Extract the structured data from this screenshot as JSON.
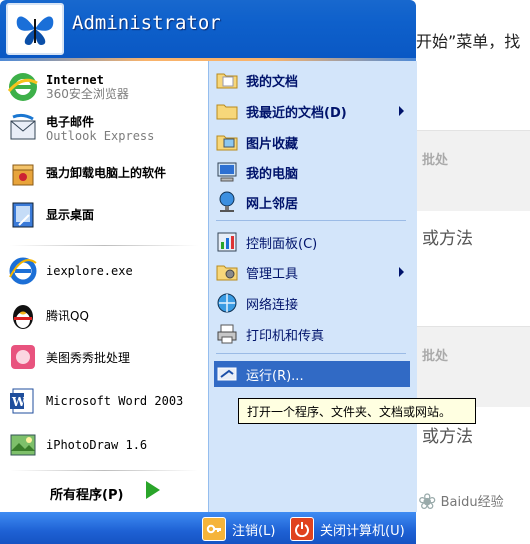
{
  "background": {
    "text1": "开始”菜单，找",
    "card1_label": "批处",
    "card2_text": "或方法",
    "card3_label": "批处",
    "card4_text": "或方法",
    "watermark": "Baidu经验"
  },
  "header": {
    "user": "Administrator"
  },
  "left_items": [
    {
      "name": "internet",
      "title": "Internet",
      "sub": "360安全浏览器"
    },
    {
      "name": "email",
      "title": "电子邮件",
      "sub": "Outlook Express"
    },
    {
      "name": "uninstall",
      "title": "强力卸载电脑上的软件"
    },
    {
      "name": "show-desktop",
      "title": "显示桌面"
    },
    {
      "name": "iexplore",
      "title": "iexplore.exe"
    },
    {
      "name": "qq",
      "title": "腾讯QQ"
    },
    {
      "name": "meitu",
      "title": "美图秀秀批处理"
    },
    {
      "name": "word",
      "title": "Microsoft Word 2003"
    },
    {
      "name": "iphotodraw",
      "title": "iPhotoDraw 1.6"
    }
  ],
  "all_programs": "所有程序(P)",
  "right_items": [
    {
      "label": "我的文档",
      "bold": true
    },
    {
      "label": "我最近的文档(D)",
      "bold": true,
      "submenu": true
    },
    {
      "label": "图片收藏",
      "bold": true
    },
    {
      "label": "我的电脑",
      "bold": true
    },
    {
      "label": "网上邻居",
      "bold": true
    },
    {
      "label": "控制面板(C)"
    },
    {
      "label": "管理工具",
      "submenu": true
    },
    {
      "label": "网络连接"
    },
    {
      "label": "打印机和传真"
    },
    {
      "label": "运行(R)..."
    }
  ],
  "tooltip": "打开一个程序、文件夹、文档或网站。",
  "footer": {
    "logoff": "注销(L)",
    "shutdown": "关闭计算机(U)"
  },
  "colors": {
    "header_blue": "#0e60cb",
    "right_panel": "#d3e5fa",
    "highlight": "#316ac5"
  }
}
